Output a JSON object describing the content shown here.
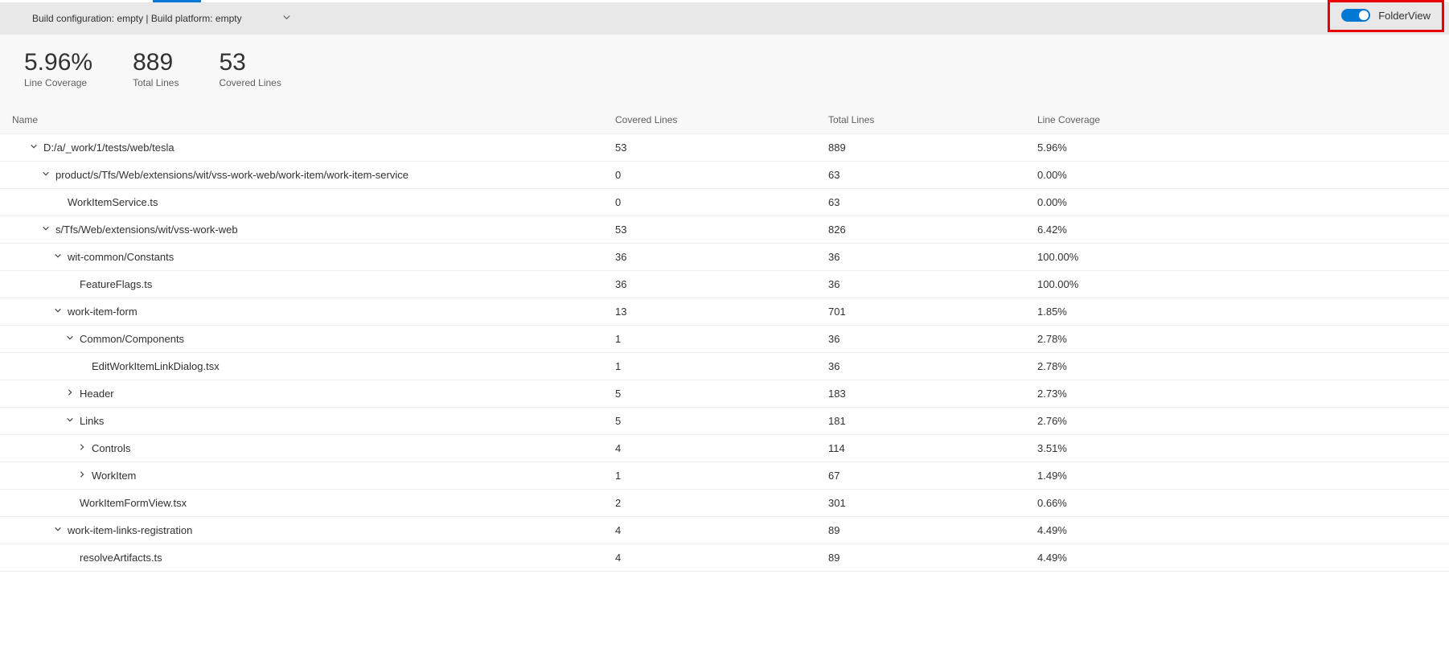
{
  "configBar": {
    "text": "Build configuration: empty | Build platform: empty"
  },
  "toggle": {
    "label": "FolderView",
    "on": true
  },
  "metrics": [
    {
      "value": "5.96%",
      "label": "Line Coverage"
    },
    {
      "value": "889",
      "label": "Total Lines"
    },
    {
      "value": "53",
      "label": "Covered Lines"
    }
  ],
  "columns": {
    "name": "Name",
    "covered": "Covered Lines",
    "total": "Total Lines",
    "coverage": "Line Coverage"
  },
  "rows": [
    {
      "indent": 1,
      "chevron": "down",
      "name": "D:/a/_work/1/tests/web/tesla",
      "covered": "53",
      "total": "889",
      "coverage": "5.96%"
    },
    {
      "indent": 2,
      "chevron": "down",
      "name": "product/s/Tfs/Web/extensions/wit/vss-work-web/work-item/work-item-service",
      "covered": "0",
      "total": "63",
      "coverage": "0.00%"
    },
    {
      "indent": 3,
      "chevron": "none",
      "name": "WorkItemService.ts",
      "covered": "0",
      "total": "63",
      "coverage": "0.00%"
    },
    {
      "indent": 2,
      "chevron": "down",
      "name": "s/Tfs/Web/extensions/wit/vss-work-web",
      "covered": "53",
      "total": "826",
      "coverage": "6.42%"
    },
    {
      "indent": 3,
      "chevron": "down",
      "name": "wit-common/Constants",
      "covered": "36",
      "total": "36",
      "coverage": "100.00%"
    },
    {
      "indent": 4,
      "chevron": "none",
      "name": "FeatureFlags.ts",
      "covered": "36",
      "total": "36",
      "coverage": "100.00%"
    },
    {
      "indent": 3,
      "chevron": "down",
      "name": "work-item-form",
      "covered": "13",
      "total": "701",
      "coverage": "1.85%"
    },
    {
      "indent": 4,
      "chevron": "down",
      "name": "Common/Components",
      "covered": "1",
      "total": "36",
      "coverage": "2.78%"
    },
    {
      "indent": 5,
      "chevron": "none",
      "name": "EditWorkItemLinkDialog.tsx",
      "covered": "1",
      "total": "36",
      "coverage": "2.78%"
    },
    {
      "indent": 4,
      "chevron": "right",
      "name": "Header",
      "covered": "5",
      "total": "183",
      "coverage": "2.73%"
    },
    {
      "indent": 4,
      "chevron": "down",
      "name": "Links",
      "covered": "5",
      "total": "181",
      "coverage": "2.76%"
    },
    {
      "indent": 5,
      "chevron": "right",
      "name": "Controls",
      "covered": "4",
      "total": "114",
      "coverage": "3.51%"
    },
    {
      "indent": 5,
      "chevron": "right",
      "name": "WorkItem",
      "covered": "1",
      "total": "67",
      "coverage": "1.49%"
    },
    {
      "indent": 4,
      "chevron": "none",
      "name": "WorkItemFormView.tsx",
      "covered": "2",
      "total": "301",
      "coverage": "0.66%"
    },
    {
      "indent": 3,
      "chevron": "down",
      "name": "work-item-links-registration",
      "covered": "4",
      "total": "89",
      "coverage": "4.49%"
    },
    {
      "indent": 4,
      "chevron": "none",
      "name": "resolveArtifacts.ts",
      "covered": "4",
      "total": "89",
      "coverage": "4.49%"
    }
  ]
}
